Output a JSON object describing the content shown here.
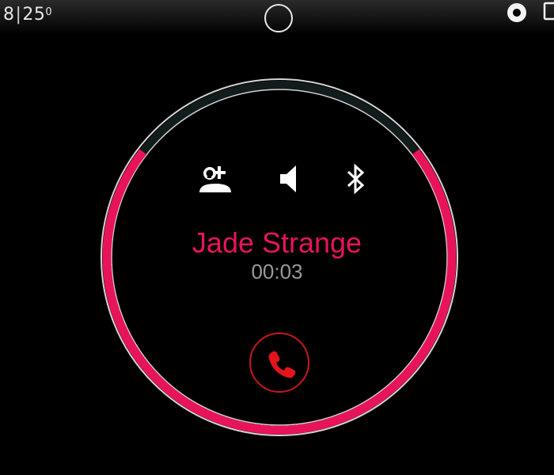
{
  "status_bar": {
    "time_hours": "8",
    "time_separator": "|",
    "time_minutes": "25",
    "temperature_symbol": "0",
    "icons": [
      "home-circle-icon",
      "record-icon",
      "tablet-icon"
    ]
  },
  "call": {
    "caller_name": "Jade Strange",
    "duration": "00:03",
    "actions": [
      "add-contact-icon",
      "speaker-icon",
      "bluetooth-icon",
      "end-call-icon"
    ]
  },
  "colors": {
    "accent": "#e8145a",
    "end_call": "#c8151e",
    "timer_text": "#9a9a9a",
    "background": "#000000"
  }
}
